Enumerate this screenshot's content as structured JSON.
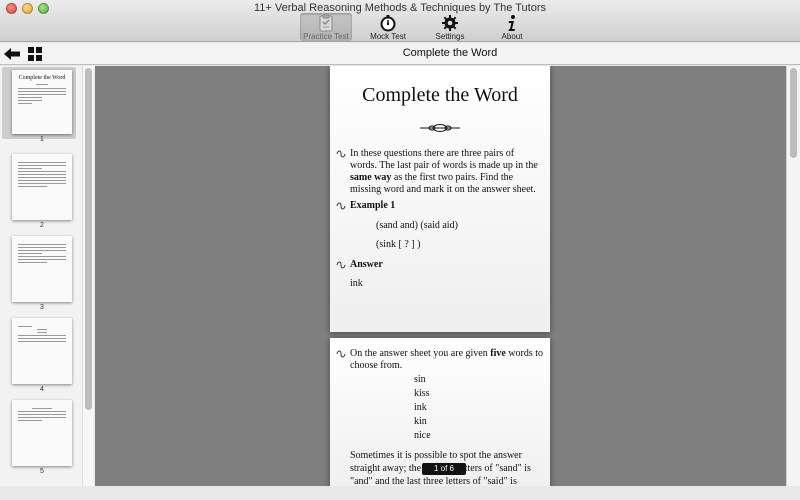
{
  "window": {
    "title": "11+ Verbal Reasoning Methods & Techniques by The Tutors"
  },
  "toolbar": {
    "items": [
      {
        "label": "Practice Test",
        "icon": "practice-test-icon",
        "active": true
      },
      {
        "label": "Mock Test",
        "icon": "stopwatch-icon",
        "active": false
      },
      {
        "label": "Settings",
        "icon": "gear-icon",
        "active": false
      },
      {
        "label": "About",
        "icon": "info-icon",
        "active": false
      }
    ]
  },
  "nav": {
    "title": "Complete the Word"
  },
  "sidebar": {
    "thumbnails": [
      {
        "number": "1",
        "title": "Complete the Word",
        "selected": true
      },
      {
        "number": "2",
        "selected": false
      },
      {
        "number": "3",
        "selected": false
      },
      {
        "number": "4",
        "selected": false
      },
      {
        "number": "5",
        "selected": false
      }
    ]
  },
  "page1": {
    "title": "Complete the Word",
    "intro_lines": [
      "In these questions there are three pairs of",
      "words. The last pair of words is made up in the",
      "same way as the first two pairs. Find the",
      "missing word and mark it on the answer sheet."
    ],
    "example_heading": "Example 1",
    "example_line1": "(sand   and)   (said   aid)",
    "example_line2": "(sink   [ ? ] )",
    "answer_heading": "Answer",
    "answer_value": "ink"
  },
  "page2": {
    "intro_lines": [
      "On the answer sheet you are given five words to",
      "choose from."
    ],
    "choices": [
      "sin",
      "kiss",
      "ink",
      "kin",
      "nice"
    ],
    "outro_lines": [
      "Sometimes it is possible to spot the answer",
      "straight away; the last two letters of \"sand\" is",
      "\"and\" and the last three letters of \"said\" is"
    ]
  },
  "pager": {
    "indicator": "1 of 6"
  },
  "colors": {
    "page_bg": "#7f7f7f",
    "sidebar_bg": "#f2f2f2",
    "indicator_bg": "#111111"
  }
}
